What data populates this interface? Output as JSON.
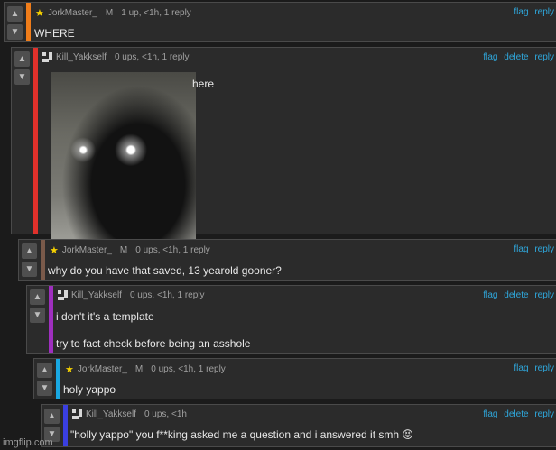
{
  "colors": {
    "orange": "#f07d1a",
    "red": "#e0312b",
    "brown": "#7a5a4a",
    "purple": "#9f2fbf",
    "cyan": "#19a8e2",
    "blue": "#3a3fe0",
    "link": "#2fa8dd"
  },
  "comments": [
    {
      "user": "JorkMaster_",
      "flair": "M",
      "info": "1 up, <1h, 1 reply",
      "actions": [
        "flag",
        "reply"
      ],
      "text": "WHERE",
      "icon": "star-icon"
    },
    {
      "user": "Kill_Yakkself",
      "flair": "",
      "info": "0 ups, <1h, 1 reply",
      "actions": [
        "flag",
        "delete",
        "reply"
      ],
      "text": "here",
      "icon": "pixel-avatar-icon"
    },
    {
      "user": "JorkMaster_",
      "flair": "M",
      "info": "0 ups, <1h, 1 reply",
      "actions": [
        "flag",
        "reply"
      ],
      "text": "why do you have that saved, 13 yearold gooner?",
      "icon": "star-icon"
    },
    {
      "user": "Kill_Yakkself",
      "flair": "",
      "info": "0 ups, <1h, 1 reply",
      "actions": [
        "flag",
        "delete",
        "reply"
      ],
      "text": "i don't it's a template",
      "text2": "try to fact check before being an asshole",
      "icon": "pixel-avatar-icon"
    },
    {
      "user": "JorkMaster_",
      "flair": "M",
      "info": "0 ups, <1h, 1 reply",
      "actions": [
        "flag",
        "reply"
      ],
      "text": "holy yappo",
      "icon": "star-icon"
    },
    {
      "user": "Kill_Yakkself",
      "flair": "",
      "info": "0 ups, <1h",
      "actions": [
        "flag",
        "delete",
        "reply"
      ],
      "text": "\"holly yappo\" you f**king asked me a question and i answered it smh 😝",
      "icon": "pixel-avatar-icon"
    }
  ],
  "watermark": "imgflip.com"
}
